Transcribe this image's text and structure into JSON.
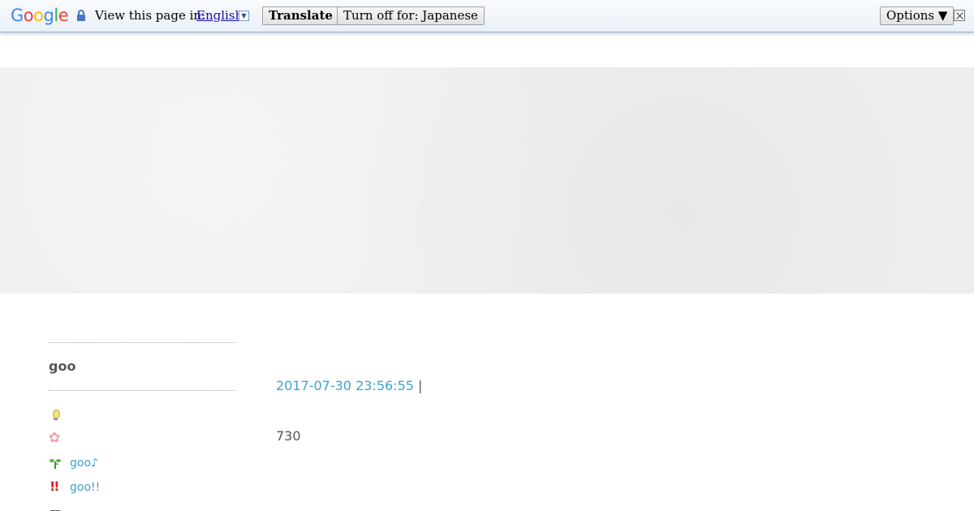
{
  "translate_bar": {
    "logo": "Google",
    "view_label": "View this page in:",
    "language": "English",
    "translate_button": "Translate",
    "turn_off_button": "Turn off for: Japanese",
    "options_button": "Options ▼",
    "colors": {
      "link": "#1a0dab",
      "border": "#8fb0d8"
    }
  },
  "sidebar": {
    "title": "goo",
    "items": [
      {
        "icon": "lightbulb-icon",
        "label": ""
      },
      {
        "icon": "flower-icon",
        "label": ""
      },
      {
        "icon": "sprout-icon",
        "label": "goo♪"
      },
      {
        "icon": "exclamation-icon",
        "label": "goo!!"
      },
      {
        "icon": "camera-icon",
        "label": ""
      }
    ]
  },
  "post": {
    "timestamp": "2017-07-30 23:56:55",
    "separator": "|",
    "body": "730"
  },
  "colors": {
    "accent": "#3ba0d2",
    "text": "#555555",
    "banner": "#efefef"
  }
}
